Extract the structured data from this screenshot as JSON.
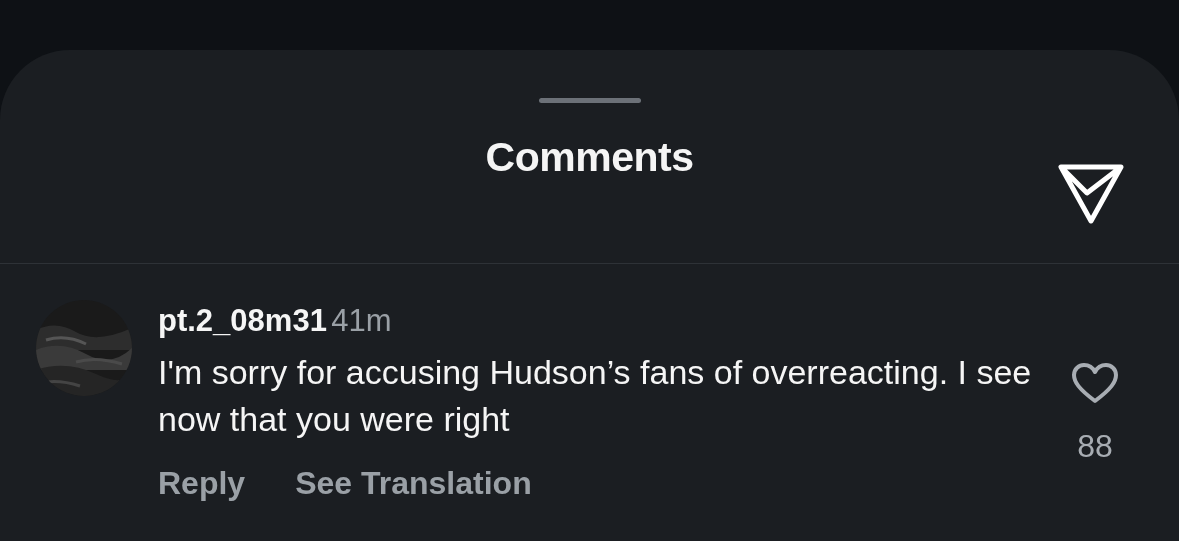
{
  "sheet": {
    "title": "Comments"
  },
  "comments": [
    {
      "username": "pt.2_08m31",
      "time": "41m",
      "text": "I'm sorry for accusing Hudson’s fans of overreacting. I see now that you were right",
      "liked": false,
      "likes": "88",
      "actions": [
        "Reply",
        "See Translation"
      ]
    }
  ]
}
